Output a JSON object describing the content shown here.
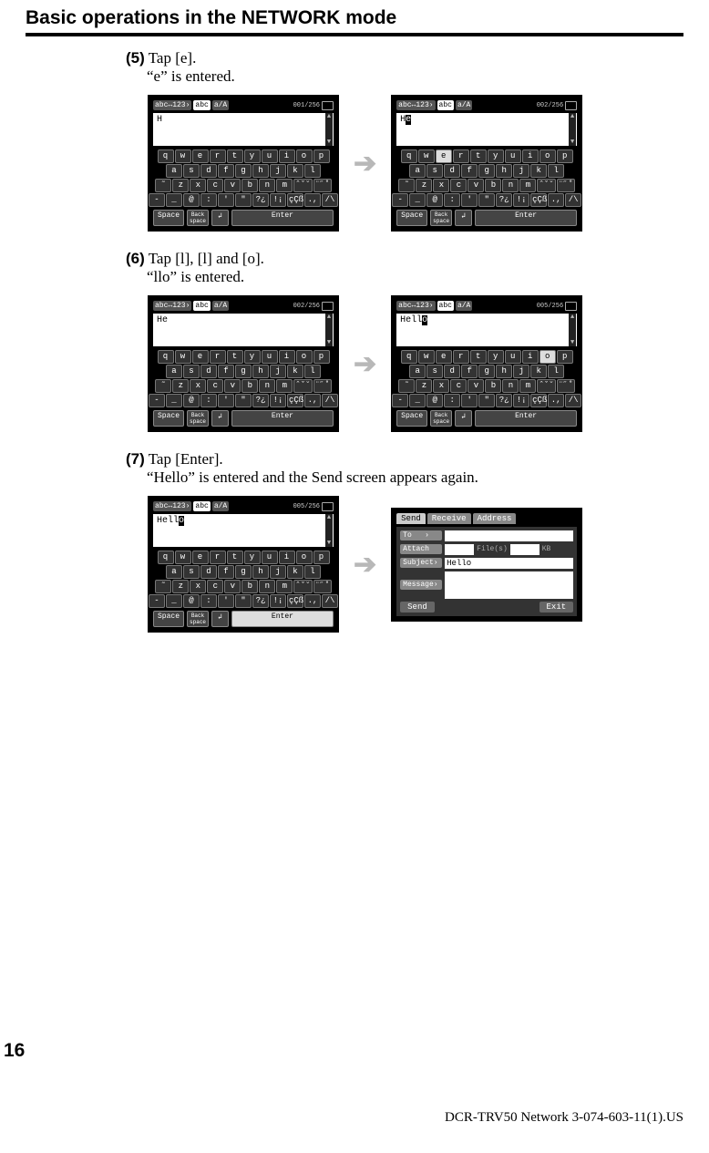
{
  "title": "Basic operations in the NETWORK mode",
  "steps": {
    "s5": {
      "num": "(5)",
      "action": "Tap [e].",
      "result": "“e” is entered."
    },
    "s6": {
      "num": "(6)",
      "action": "Tap [l], [l] and [o].",
      "result": "“llo” is entered."
    },
    "s7": {
      "num": "(7)",
      "action": "Tap [Enter].",
      "result": "“Hello” is entered and the Send screen appears again."
    }
  },
  "kbd": {
    "tab_mode": "abc↔123›",
    "tab_abc": "abc",
    "tab_case": "a/A",
    "row1": [
      "q",
      "w",
      "e",
      "r",
      "t",
      "y",
      "u",
      "i",
      "o",
      "p"
    ],
    "row2": [
      "a",
      "s",
      "d",
      "f",
      "g",
      "h",
      "j",
      "k",
      "l"
    ],
    "row3": [
      "˜",
      "z",
      "x",
      "c",
      "v",
      "b",
      "n",
      "m",
      "ˆˇ˘",
      "¨˝˚"
    ],
    "row4": [
      "-",
      "_",
      "@",
      ":",
      "'",
      "\"",
      "?¿",
      "!¡",
      "çÇß",
      ".,",
      "/\\"
    ],
    "space": "Space",
    "back": "Back\nspace",
    "arrow": "↲",
    "enter": "Enter"
  },
  "screens": {
    "kb_H_001": {
      "text": "H",
      "count": "001/256",
      "highlight": ""
    },
    "kb_He_002": {
      "text": "He",
      "count": "002/256",
      "highlight": "e",
      "cursor_after": true
    },
    "kb_He_002b": {
      "text": "He",
      "count": "002/256",
      "highlight": ""
    },
    "kb_Hello_005": {
      "text": "Hello",
      "count": "005/256",
      "highlight": "o",
      "cursor_after": true
    },
    "kb_Hello_005_enter": {
      "text": "Hello",
      "count": "005/256",
      "highlight": "",
      "cursor_after": true,
      "enter_hl": true
    }
  },
  "send": {
    "tab_send": "Send",
    "tab_receive": "Receive",
    "tab_address": "Address",
    "to": "To",
    "attach": "Attach",
    "files": "File(s)",
    "kb": "KB",
    "subject": "Subject›",
    "subject_val": "Hello",
    "message": "Message›",
    "send_btn": "Send",
    "exit_btn": "Exit"
  },
  "page_num": "16",
  "footer": "DCR-TRV50 Network 3-074-603-11(1).US"
}
